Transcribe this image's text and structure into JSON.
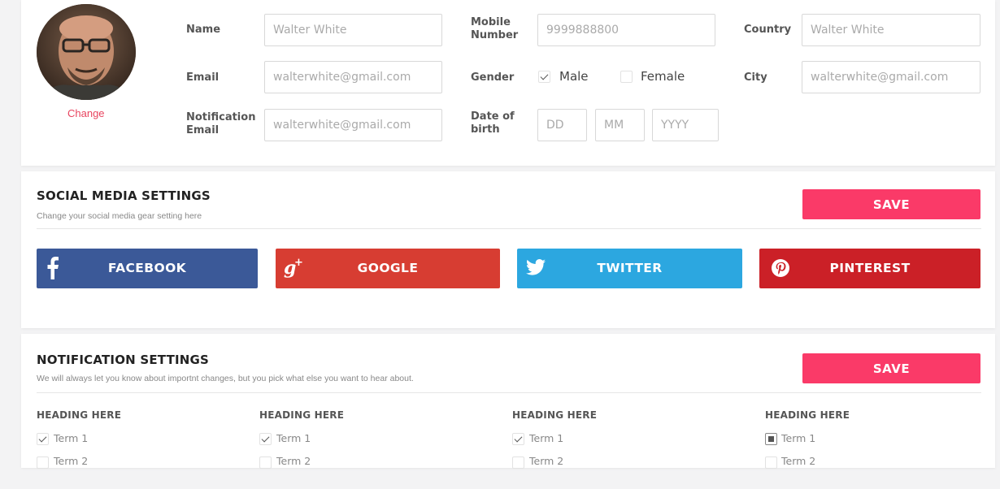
{
  "profile": {
    "change_label": "Change",
    "name": {
      "label": "Name",
      "placeholder": "Walter White"
    },
    "email": {
      "label": "Email",
      "placeholder": "walterwhite@gmail.com"
    },
    "notification_email": {
      "label": "Notification Email",
      "placeholder": "walterwhite@gmail.com"
    },
    "mobile": {
      "label": "Mobile Number",
      "placeholder": "9999888800"
    },
    "gender": {
      "label": "Gender",
      "options": [
        {
          "label": "Male",
          "checked": true
        },
        {
          "label": "Female",
          "checked": false
        }
      ]
    },
    "dob": {
      "label": "Date of birth",
      "day_placeholder": "DD",
      "month_placeholder": "MM",
      "year_placeholder": "YYYY"
    },
    "country": {
      "label": "Country",
      "placeholder": "Walter White"
    },
    "city": {
      "label": "City",
      "placeholder": "walterwhite@gmail.com"
    }
  },
  "social": {
    "title": "SOCIAL MEDIA SETTINGS",
    "subtitle": "Change your social media gear setting here",
    "save_label": "SAVE",
    "buttons": [
      {
        "label": "FACEBOOK",
        "color": "#3b5998",
        "icon": "facebook-icon"
      },
      {
        "label": "GOOGLE",
        "color": "#d73d32",
        "icon": "google-plus-icon"
      },
      {
        "label": "TWITTER",
        "color": "#2ca7e0",
        "icon": "twitter-icon"
      },
      {
        "label": "PINTEREST",
        "color": "#cb2027",
        "icon": "pinterest-icon"
      }
    ]
  },
  "notifications": {
    "title": "NOTIFICATION SETTINGS",
    "subtitle": "We will always let you know about importnt changes, but you pick what else you want to hear about.",
    "save_label": "SAVE",
    "columns": [
      {
        "heading": "HEADING HERE",
        "terms": [
          {
            "label": "Term 1",
            "state": "checked"
          },
          {
            "label": "Term 2",
            "state": "unchecked"
          }
        ]
      },
      {
        "heading": "HEADING HERE",
        "terms": [
          {
            "label": "Term 1",
            "state": "checked"
          },
          {
            "label": "Term 2",
            "state": "unchecked"
          }
        ]
      },
      {
        "heading": "HEADING HERE",
        "terms": [
          {
            "label": "Term 1",
            "state": "checked"
          },
          {
            "label": "Term 2",
            "state": "unchecked"
          }
        ]
      },
      {
        "heading": "HEADING HERE",
        "terms": [
          {
            "label": "Term 1",
            "state": "filled"
          },
          {
            "label": "Term 2",
            "state": "unchecked"
          }
        ]
      }
    ]
  },
  "colors": {
    "accent": "#fa3a68",
    "link": "#e8445f"
  }
}
